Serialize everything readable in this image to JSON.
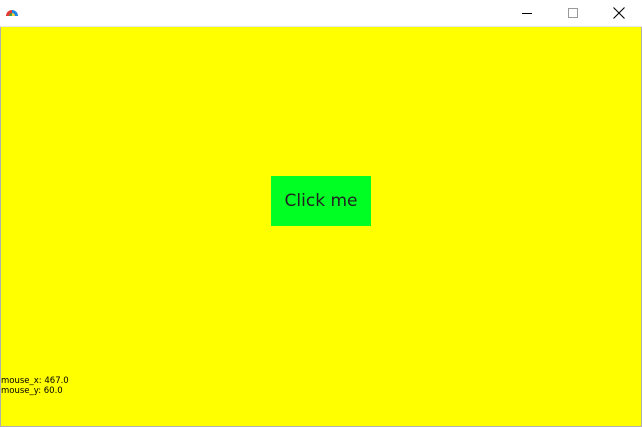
{
  "window": {
    "title": "",
    "icon": "app-color-wheel-icon",
    "controls": {
      "minimize_icon": "minimize-icon",
      "maximize_icon": "maximize-icon",
      "close_icon": "close-icon"
    }
  },
  "canvas": {
    "background_color": "#ffff00",
    "button": {
      "label": "Click me",
      "color": "#00ff22"
    },
    "readout": {
      "mouse_x": "mouse_x: 467.0",
      "mouse_y": "mouse_y: 60.0"
    }
  }
}
